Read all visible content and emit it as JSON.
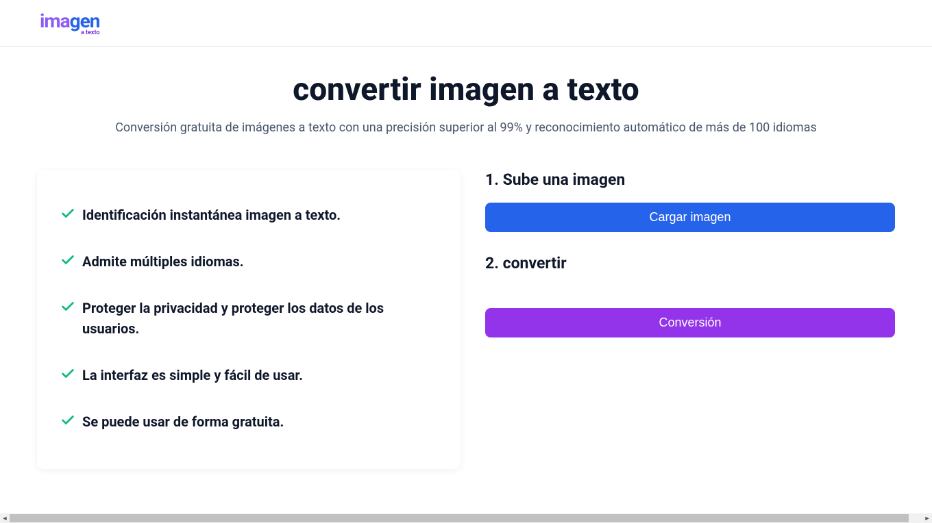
{
  "logo": {
    "text_part1": "ima",
    "text_part2": "gen",
    "subtitle": "a texto"
  },
  "hero": {
    "title": "convertir imagen a texto",
    "subtitle": "Conversión gratuita de imágenes a texto con una precisión superior al 99% y reconocimiento automático de más de 100 idiomas"
  },
  "features": [
    "Identificación instantánea imagen a texto.",
    "Admite múltiples idiomas.",
    "Proteger la privacidad y proteger los datos de los usuarios.",
    "La interfaz es simple y fácil de usar.",
    "Se puede usar de forma gratuita."
  ],
  "steps": {
    "step1_title": "1. Sube una imagen",
    "upload_button": "Cargar imagen",
    "step2_title": "2. convertir",
    "convert_button": "Conversión"
  }
}
